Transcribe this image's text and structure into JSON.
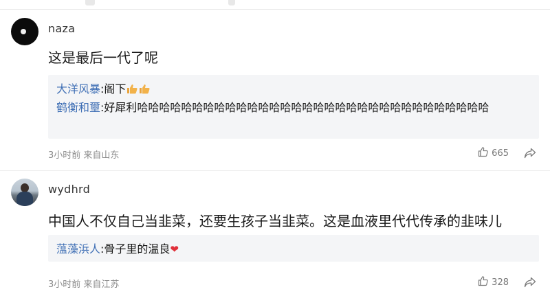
{
  "comments": [
    {
      "username": "naza",
      "text": "这是最后一代了呢",
      "replies": [
        {
          "user": "大洋风暴",
          "text": "阁下"
        },
        {
          "user": "鹤衡和壐",
          "text": "好犀利哈哈哈哈哈哈哈哈哈哈哈哈哈哈哈哈哈哈哈哈哈哈哈哈哈哈哈哈哈哈哈哈"
        }
      ],
      "meta": "3小时前 来自山东",
      "likes": "665"
    },
    {
      "username": "wydhrd",
      "text": "中国人不仅自己当韭菜，还要生孩子当韭菜。这是血液里代代传承的韭味儿",
      "replies": [
        {
          "user": "蕰藻浜人",
          "text": "骨子里的温良"
        }
      ],
      "meta": "3小时前 来自江苏",
      "likes": "328"
    }
  ],
  "icons": {
    "like": "thumbs-up-icon",
    "share": "share-icon",
    "heart": "heart-emoji",
    "thumbs": "thumbs-up-emoji"
  },
  "colors": {
    "reply_user": "#3f6fb5",
    "reply_bg": "#f4f5f7",
    "meta": "#8a8a8a",
    "heart": "#e0303a",
    "thumb_emoji": "#f2b24a"
  }
}
